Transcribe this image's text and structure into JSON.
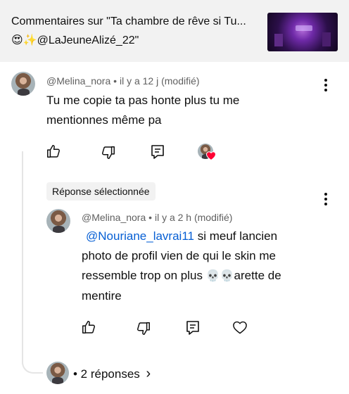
{
  "header": {
    "title_line1": "Commentaires sur \"Ta chambre de rêve si Tu...",
    "title_line2": "😍✨@LaJeuneAlizé_22\""
  },
  "comment": {
    "author": "@Melina_nora",
    "separator": "•",
    "time": "il y a 12 j (modifié)",
    "text_line1": "Tu me copie ta pas honte plus tu me",
    "text_line2": "mentionnes même pa"
  },
  "reply_section": {
    "selected_label": "Réponse sélectionnée"
  },
  "reply": {
    "author": "@Melina_nora",
    "separator": "•",
    "time": "il y a 2 h (modifié)",
    "mention": "@Nouriane_lavrai11",
    "text_after_mention": " si meuf lancien",
    "text_line2": "photo de profil  vien de  qui le skin me",
    "text_line3_start": "ressemble  trop on plus  ",
    "skulls": "💀💀",
    "text_line3_end": "arette de",
    "text_line4": "mentire"
  },
  "more_replies": {
    "label": "• 2 réponses",
    "chevron": "›"
  },
  "icons": {
    "like": "thumb-up-icon",
    "dislike": "thumb-down-icon",
    "reply": "reply-comment-icon",
    "heart": "heart-icon",
    "more": "more-vertical-icon"
  },
  "colors": {
    "accent_link": "#065fd4",
    "heart_red": "#ff0033",
    "text": "#0f0f0f",
    "muted": "#606060"
  }
}
